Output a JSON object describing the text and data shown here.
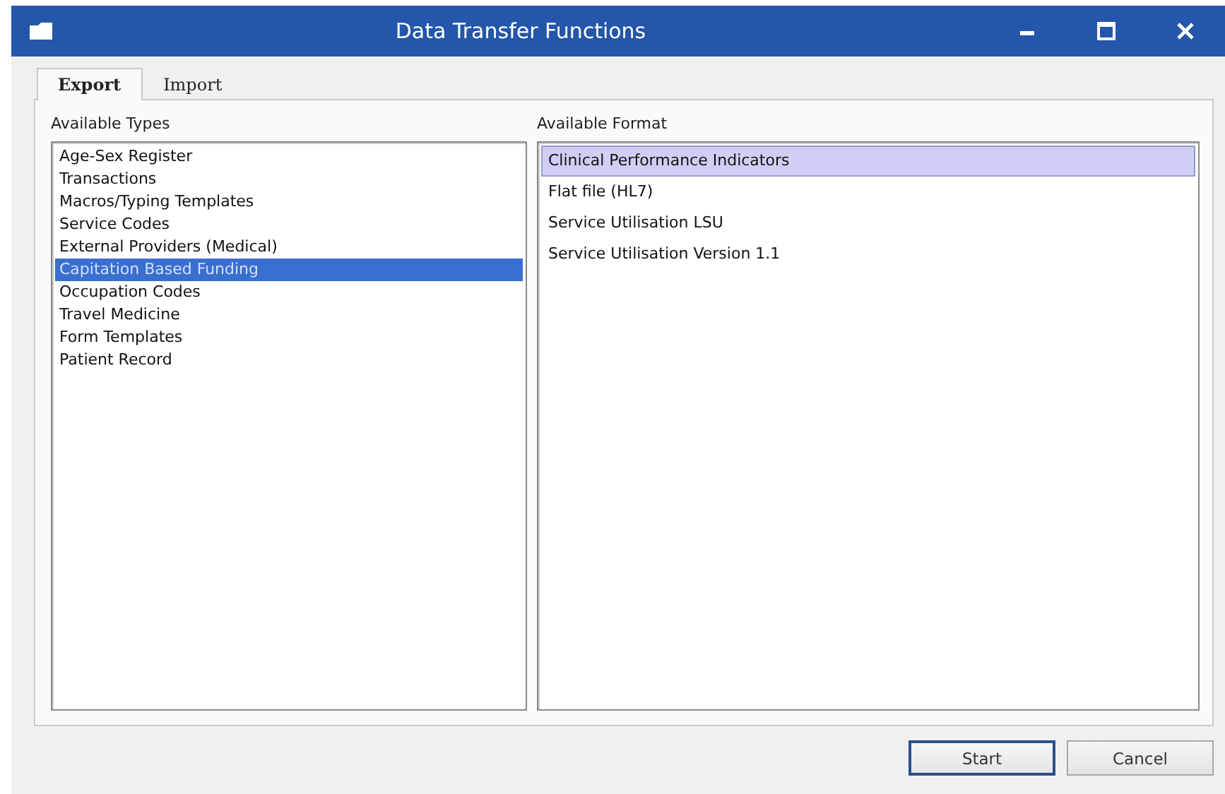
{
  "window": {
    "title": "Data Transfer Functions"
  },
  "tabs": [
    {
      "label": "Export",
      "selected": true
    },
    {
      "label": "Import",
      "selected": false
    }
  ],
  "types": {
    "label": "Available Types",
    "items": [
      {
        "label": "Age-Sex Register",
        "selected": false
      },
      {
        "label": "Transactions",
        "selected": false
      },
      {
        "label": "Macros/Typing Templates",
        "selected": false
      },
      {
        "label": "Service Codes",
        "selected": false
      },
      {
        "label": "External Providers (Medical)",
        "selected": false
      },
      {
        "label": "Capitation Based Funding",
        "selected": true
      },
      {
        "label": "Occupation Codes",
        "selected": false
      },
      {
        "label": "Travel Medicine",
        "selected": false
      },
      {
        "label": "Form Templates",
        "selected": false
      },
      {
        "label": "Patient Record",
        "selected": false
      }
    ]
  },
  "formats": {
    "label": "Available Format",
    "items": [
      {
        "label": "Clinical Performance Indicators",
        "selected": true
      },
      {
        "label": "Flat file (HL7)",
        "selected": false
      },
      {
        "label": "Service Utilisation LSU",
        "selected": false
      },
      {
        "label": "Service Utilisation Version 1.1",
        "selected": false
      }
    ]
  },
  "buttons": [
    {
      "label": "Start",
      "default": true
    },
    {
      "label": "Cancel",
      "default": false
    }
  ]
}
